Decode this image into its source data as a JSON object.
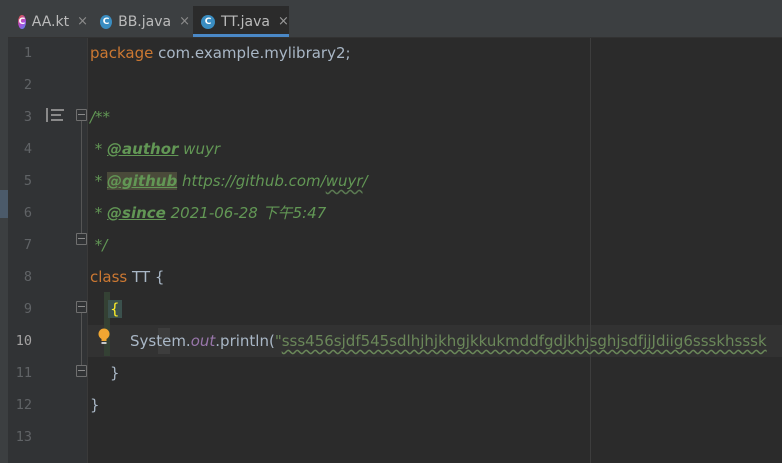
{
  "tabs": [
    {
      "label": "AA.kt",
      "icon": "kotlin-file-icon",
      "close": "×",
      "active": false
    },
    {
      "label": "BB.java",
      "icon": "java-class-icon",
      "close": "×",
      "active": false
    },
    {
      "label": "TT.java",
      "icon": "java-class-icon",
      "close": "×",
      "active": true
    }
  ],
  "line_numbers": [
    "1",
    "2",
    "3",
    "4",
    "5",
    "6",
    "7",
    "8",
    "9",
    "10",
    "11",
    "12",
    "13"
  ],
  "current_line": "10",
  "code": {
    "l1_kw": "package",
    "l1_rest": " com.example.mylibrary2;",
    "l3": "/**",
    "l4_star": " * ",
    "l4_tag": "@author",
    "l4_val": " wuyr",
    "l5_star": " * ",
    "l5_tag": "@github",
    "l5_val": " https://github.com/",
    "l5_val_typo": "wuyr",
    "l5_val_end": "/",
    "l6_star": " * ",
    "l6_tag": "@since",
    "l6_val": " 2021-06-28 下午5:47",
    "l7": " */",
    "l8_kw": "class",
    "l8_rest": " TT {",
    "l9_brace": "{",
    "l10_sys": "System.",
    "l10_field": "out",
    "l10_call": ".println(",
    "l10_str_open": "\"",
    "l10_str": "sss456sjdf545sdlhjhjkhgjkkukmddfgdjkhjsghjsdfjjJdiig6ssskhsssk",
    "l11_brace": "}",
    "l12_brace": "}"
  },
  "colors": {
    "keyword": "#cc7832",
    "doc_comment": "#629755",
    "string": "#6a8759",
    "field": "#9876aa",
    "default_text": "#a9b7c6",
    "active_tab_underline": "#4a88c7"
  }
}
